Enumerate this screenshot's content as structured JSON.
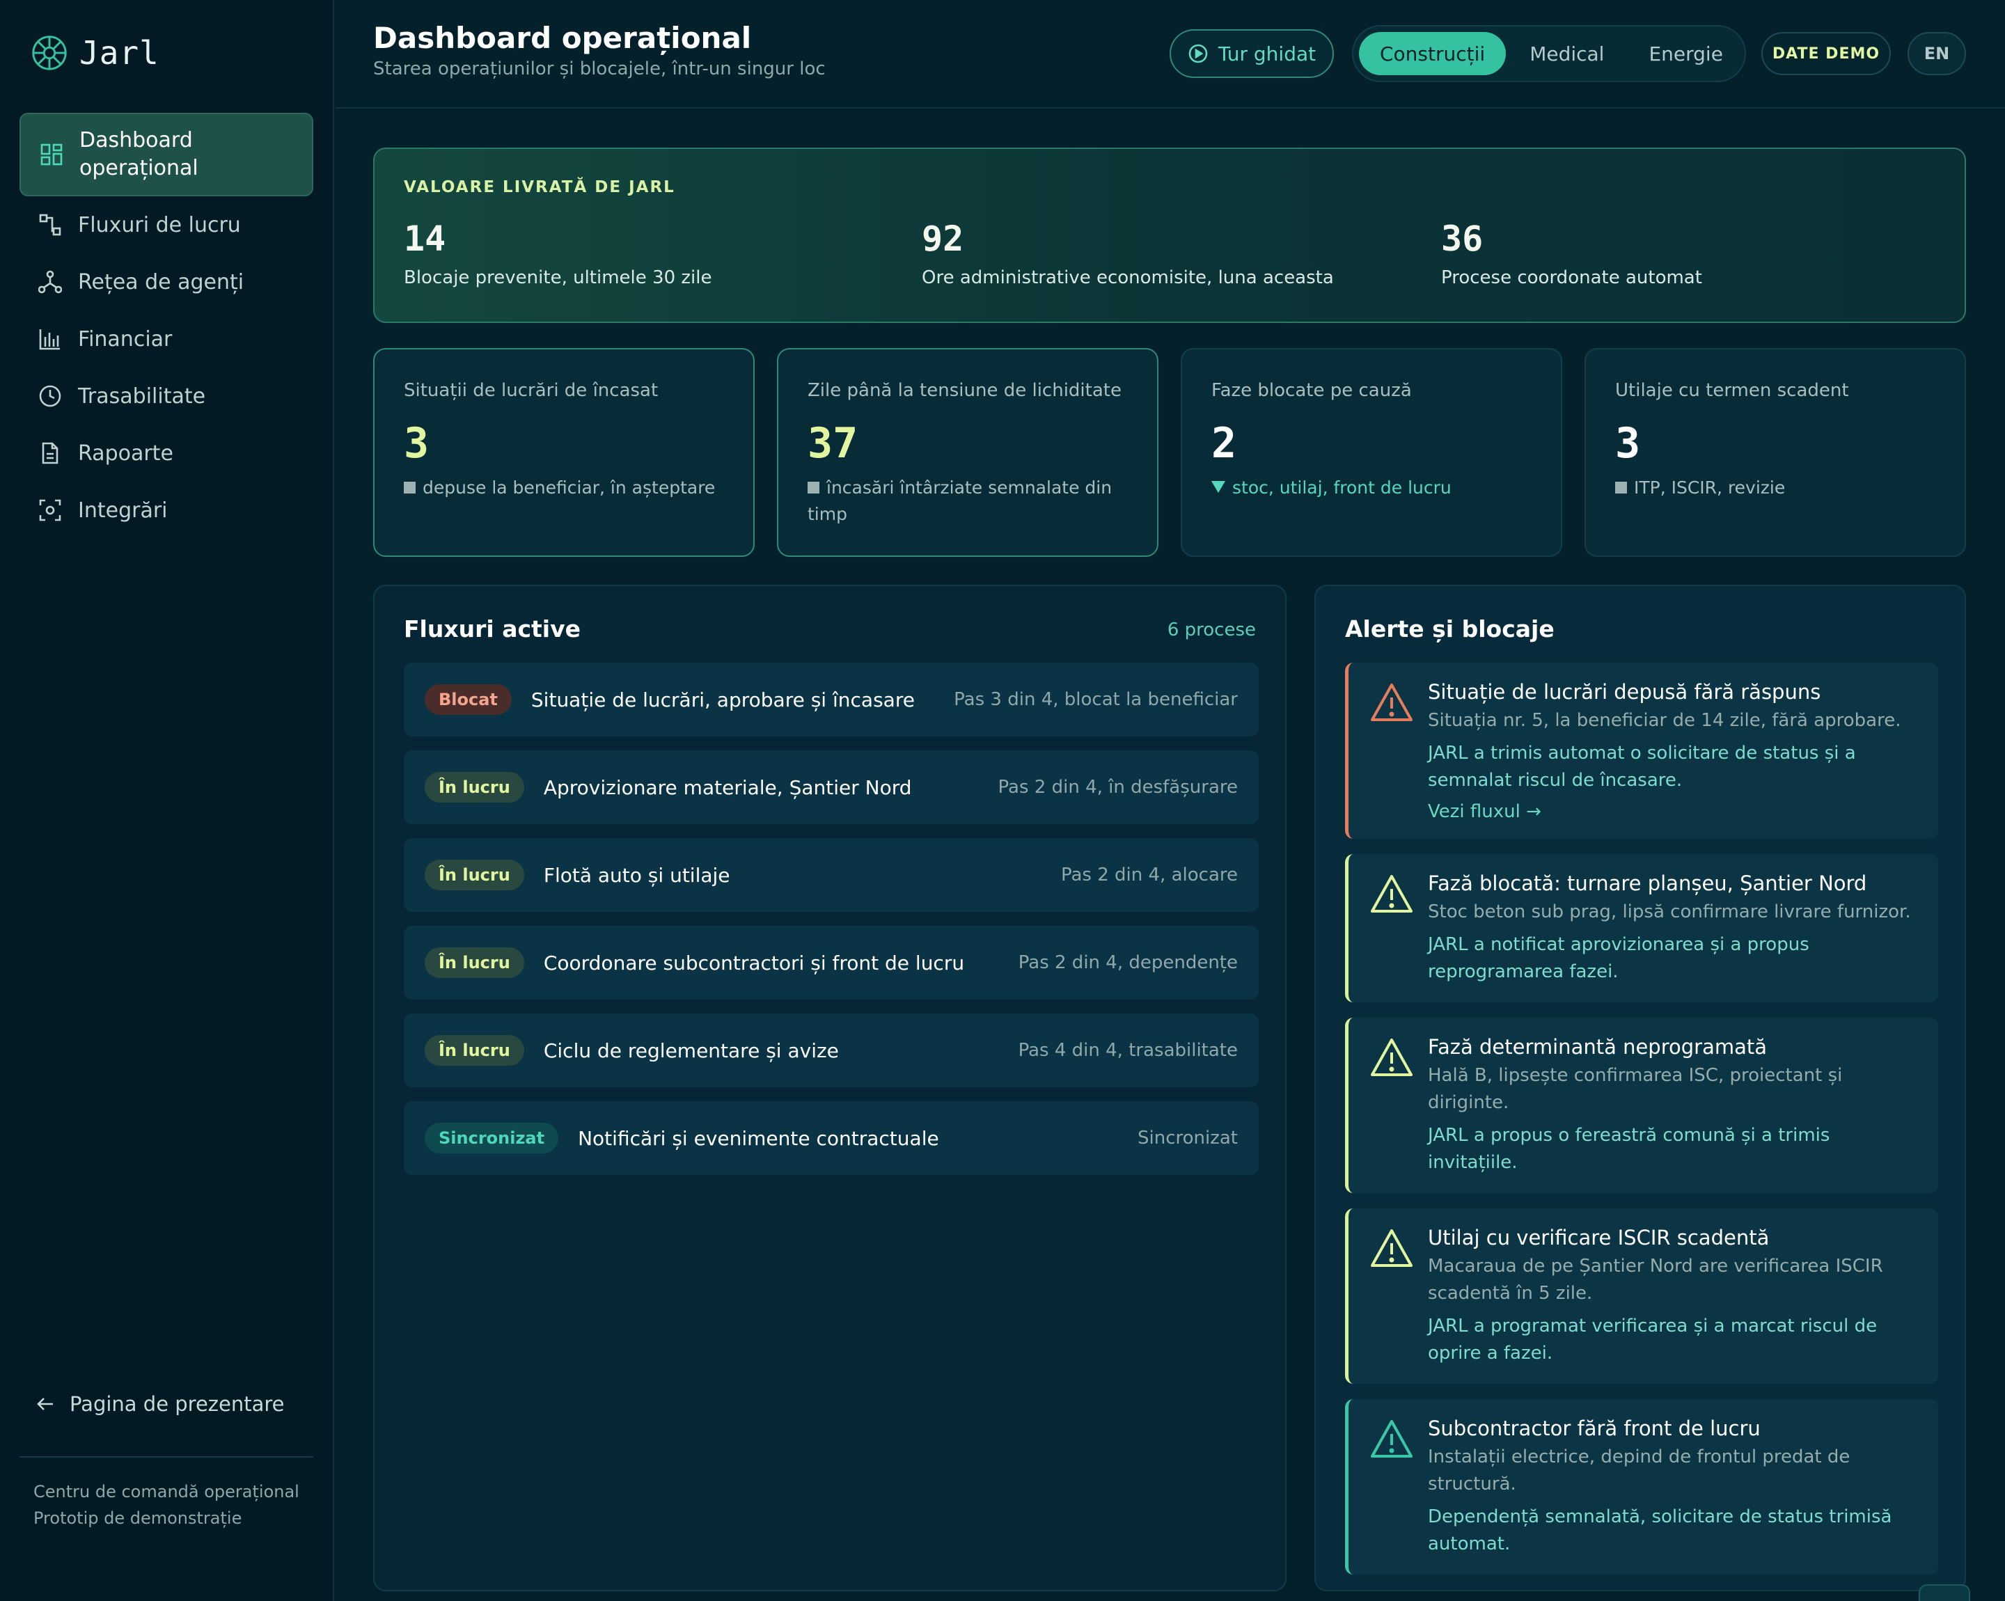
{
  "app": {
    "name": "Jarl"
  },
  "sidebar": {
    "items": [
      {
        "label": "Dashboard operațional",
        "icon": "grid-icon",
        "active": true
      },
      {
        "label": "Fluxuri de lucru",
        "icon": "workflow-icon"
      },
      {
        "label": "Rețea de agenți",
        "icon": "network-icon"
      },
      {
        "label": "Financiar",
        "icon": "bar-chart-icon"
      },
      {
        "label": "Trasabilitate",
        "icon": "clock-icon"
      },
      {
        "label": "Rapoarte",
        "icon": "document-icon"
      },
      {
        "label": "Integrări",
        "icon": "scan-icon"
      }
    ],
    "back_link": "Pagina de prezentare",
    "footer_line1": "Centru de comandă operațional",
    "footer_line2": "Prototip de demonstrație"
  },
  "header": {
    "title": "Dashboard operațional",
    "subtitle": "Starea operațiunilor și blocajele, într-un singur loc",
    "tour_button": "Tur ghidat",
    "segments": [
      "Construcții",
      "Medical",
      "Energie"
    ],
    "active_segment": "Construcții",
    "demo_badge": "DATE DEMO",
    "lang_button": "EN"
  },
  "value_banner": {
    "title": "VALOARE LIVRATĂ DE JARL",
    "stats": [
      {
        "value": "14",
        "label": "Blocaje prevenite, ultimele 30 zile"
      },
      {
        "value": "92",
        "label": "Ore administrative economisite, luna aceasta"
      },
      {
        "value": "36",
        "label": "Procese coordonate automat"
      }
    ]
  },
  "kpis": [
    {
      "title": "Situații de lucrări de încasat",
      "value": "3",
      "note": "depuse la beneficiar, în așteptare",
      "marker": "square"
    },
    {
      "title": "Zile până la tensiune de lichiditate",
      "value": "37",
      "note": "încasări întârziate semnalate din timp",
      "marker": "square"
    },
    {
      "title": "Faze blocate pe cauză",
      "value": "2",
      "note": "stoc, utilaj, front de lucru",
      "marker": "triangle-down"
    },
    {
      "title": "Utilaje cu termen scadent",
      "value": "3",
      "note": "ITP, ISCIR, revizie",
      "marker": "square"
    }
  ],
  "flows": {
    "title": "Fluxuri active",
    "count": "6 procese",
    "rows": [
      {
        "status": "Blocat",
        "name": "Situație de lucrări, aprobare și încasare",
        "step": "Pas 3 din 4, blocat la beneficiar"
      },
      {
        "status": "În lucru",
        "name": "Aprovizionare materiale, Șantier Nord",
        "step": "Pas 2 din 4, în desfășurare"
      },
      {
        "status": "În lucru",
        "name": "Flotă auto și utilaje",
        "step": "Pas 2 din 4, alocare"
      },
      {
        "status": "În lucru",
        "name": "Coordonare subcontractori și front de lucru",
        "step": "Pas 2 din 4, dependențe"
      },
      {
        "status": "În lucru",
        "name": "Ciclu de reglementare și avize",
        "step": "Pas 4 din 4, trasabilitate"
      },
      {
        "status": "Sincronizat",
        "name": "Notificări și evenimente contractuale",
        "step": "Sincronizat"
      }
    ]
  },
  "alerts": {
    "title": "Alerte și blocaje",
    "items": [
      {
        "title": "Situație de lucrări depusă fără răspuns",
        "desc": "Situația nr. 5, la beneficiar de 14 zile, fără aprobare.",
        "action": "JARL a trimis automat o solicitare de status și a semnalat riscul de încasare.",
        "link": "Vezi fluxul →",
        "severity": "critical"
      },
      {
        "title": "Fază blocată: turnare planșeu, Șantier Nord",
        "desc": "Stoc beton sub prag, lipsă confirmare livrare furnizor.",
        "action": "JARL a notificat aprovizionarea și a propus reprogramarea fazei.",
        "severity": "warning"
      },
      {
        "title": "Fază determinantă neprogramată",
        "desc": "Hală B, lipsește confirmarea ISC, proiectant și diriginte.",
        "action": "JARL a propus o fereastră comună și a trimis invitațiile.",
        "severity": "warning"
      },
      {
        "title": "Utilaj cu verificare ISCIR scadentă",
        "desc": "Macaraua de pe Șantier Nord are verificarea ISCIR scadentă în 5 zile.",
        "action": "JARL a programat verificarea și a marcat riscul de oprire a fazei.",
        "severity": "warning"
      },
      {
        "title": "Subcontractor fără front de lucru",
        "desc": "Instalații electrice, depind de frontul predat de structură.",
        "action": "Dependență semnalată, solicitare de status trimisă automat.",
        "severity": "info"
      }
    ]
  },
  "colors": {
    "accent": "#34c2a0",
    "lime": "#e2f6a0",
    "critical": "#e77d5c",
    "background": "#04202b"
  }
}
